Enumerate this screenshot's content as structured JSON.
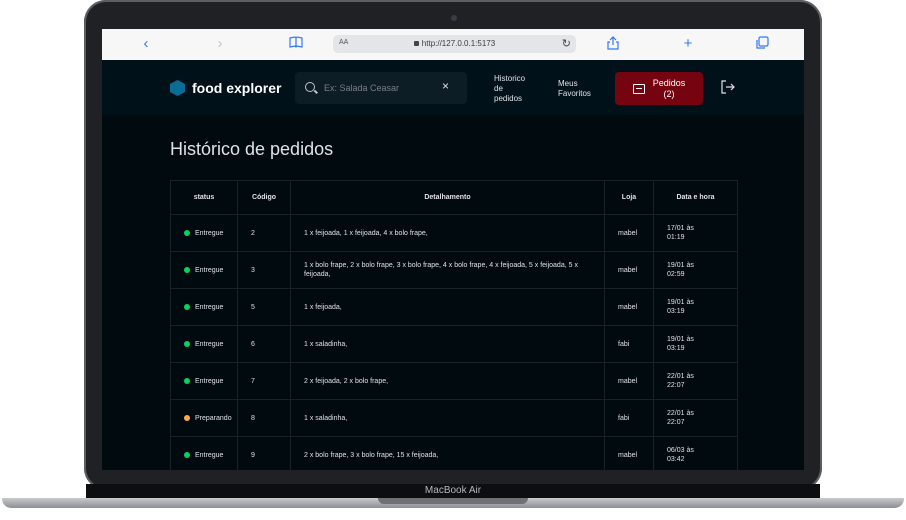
{
  "device": {
    "label": "MacBook Air"
  },
  "browser": {
    "address_prefix": "AA",
    "url": "http://127.0.0.1:5173",
    "icons": [
      "chevron-left-icon",
      "chevron-right-icon",
      "book-icon",
      "reload-icon",
      "share-icon",
      "plus-icon",
      "tabs-icon"
    ]
  },
  "header": {
    "brand": "food explorer",
    "search_placeholder": "Ex: Salada Ceasar",
    "nav_history": [
      "Historico",
      "de",
      "pedidos"
    ],
    "nav_favorites": [
      "Meus",
      "Favoritos"
    ],
    "orders_label": "Pedidos",
    "orders_count": "(2)"
  },
  "page": {
    "title": "Histórico de pedidos",
    "columns": [
      "status",
      "Código",
      "Detalhamento",
      "Loja",
      "Data e hora"
    ],
    "rows": [
      {
        "status": "Entregue",
        "code": "2",
        "detail": "1 x feijoada, 1 x feijoada, 4 x bolo frape,",
        "store": "mabel",
        "datetime": [
          "17/01 às",
          "01:19"
        ]
      },
      {
        "status": "Entregue",
        "code": "3",
        "detail": "1 x bolo frape, 2 x bolo frape, 3 x bolo frape, 4 x bolo frape, 4 x feijoada, 5 x feijoada, 5 x feijoada,",
        "store": "mabel",
        "datetime": [
          "19/01 às",
          "02:59"
        ]
      },
      {
        "status": "Entregue",
        "code": "5",
        "detail": "1 x feijoada,",
        "store": "mabel",
        "datetime": [
          "19/01 às",
          "03:19"
        ]
      },
      {
        "status": "Entregue",
        "code": "6",
        "detail": "1 x saladinha,",
        "store": "fabi",
        "datetime": [
          "19/01 às",
          "03:19"
        ]
      },
      {
        "status": "Entregue",
        "code": "7",
        "detail": "2 x feijoada, 2 x bolo frape,",
        "store": "mabel",
        "datetime": [
          "22/01 às",
          "22:07"
        ]
      },
      {
        "status": "Preparando",
        "code": "8",
        "detail": "1 x saladinha,",
        "store": "fabi",
        "datetime": [
          "22/01 às",
          "22:07"
        ]
      },
      {
        "status": "Entregue",
        "code": "9",
        "detail": "2 x bolo frape, 3 x bolo frape, 15 x feijoada,",
        "store": "mabel",
        "datetime": [
          "06/03 às",
          "03:42"
        ]
      }
    ]
  },
  "colors": {
    "background": "#000a0f",
    "header": "#00111a",
    "accent_red": "#750310",
    "status_delivered": "#04d361",
    "status_preparing": "#fba94c"
  }
}
